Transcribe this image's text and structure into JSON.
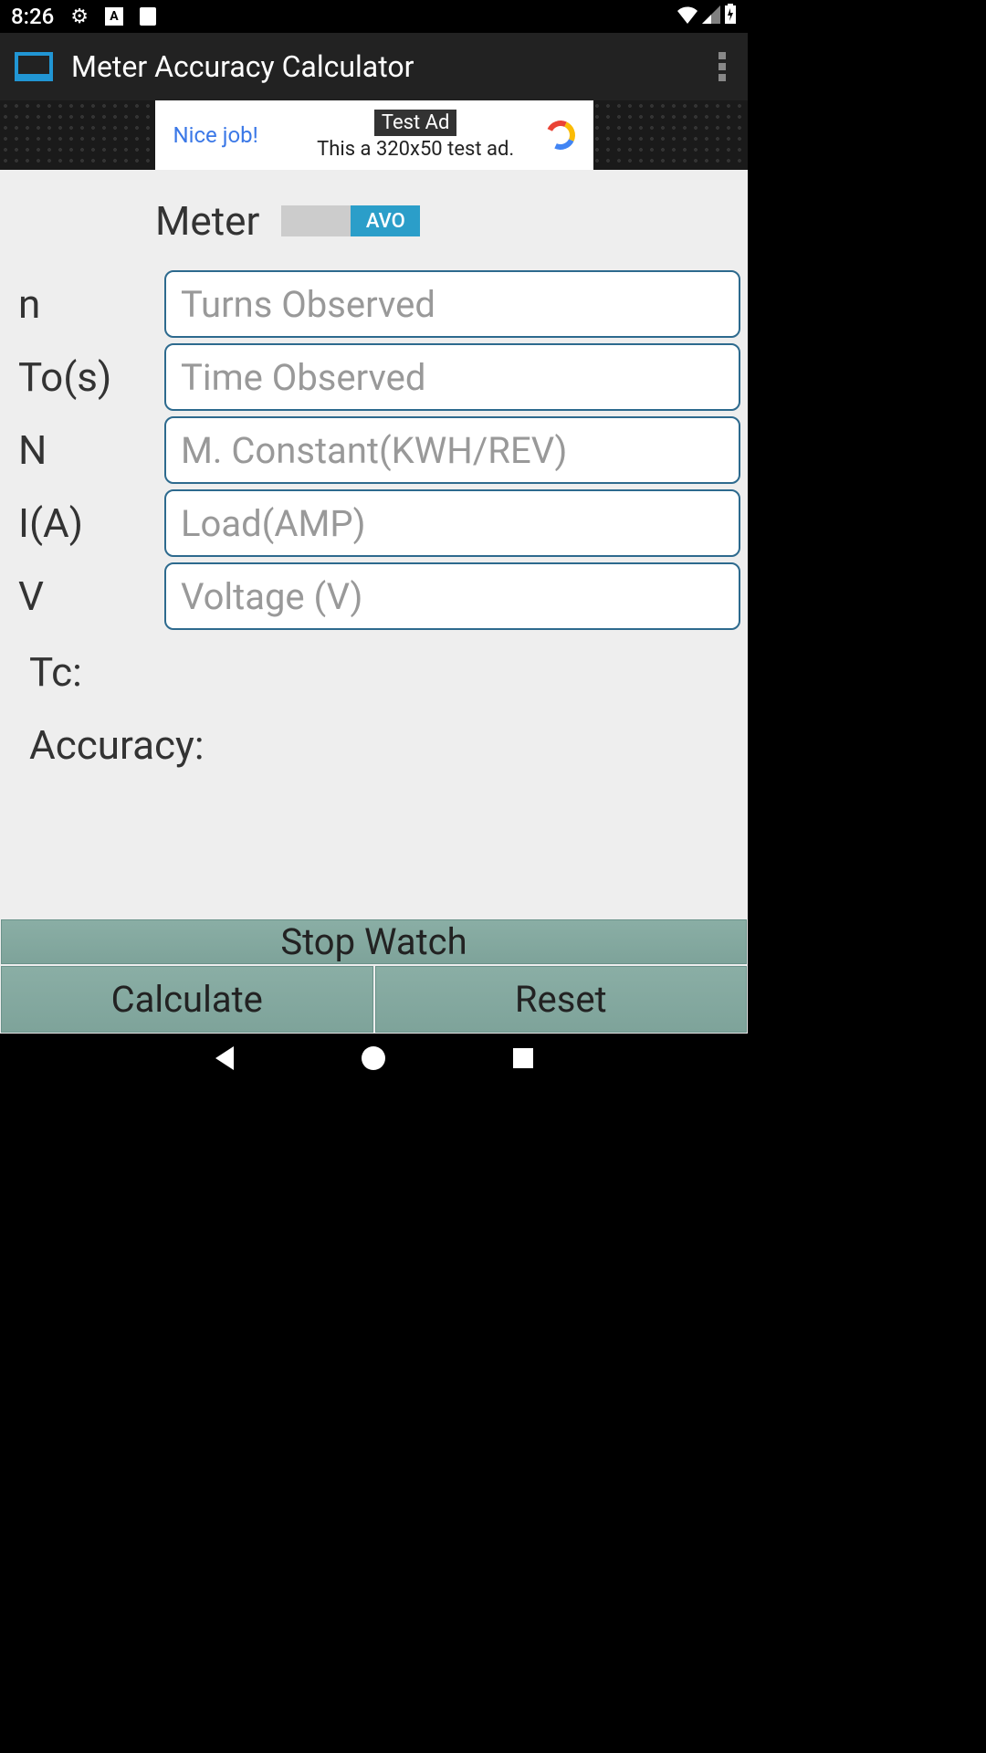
{
  "status": {
    "time": "8:26",
    "icons": {
      "gear": "⚙",
      "a": "A",
      "sd": "▭"
    }
  },
  "appbar": {
    "title": "Meter Accuracy Calculator"
  },
  "ad": {
    "nice": "Nice job!",
    "label": "Test Ad",
    "sub": "This a 320x50 test ad."
  },
  "meter": {
    "label": "Meter",
    "active_option": "AVO"
  },
  "fields": [
    {
      "label": "n",
      "placeholder": "Turns Observed"
    },
    {
      "label": "To(s)",
      "placeholder": "Time Observed"
    },
    {
      "label": "N",
      "placeholder": "M. Constant(KWH/REV)"
    },
    {
      "label": "I(A)",
      "placeholder": "Load(AMP)"
    },
    {
      "label": "V",
      "placeholder": "Voltage (V)"
    }
  ],
  "results": {
    "tc_label": "Tc:",
    "accuracy_label": "Accuracy:"
  },
  "buttons": {
    "stopwatch": "Stop Watch",
    "calculate": "Calculate",
    "reset": "Reset"
  }
}
